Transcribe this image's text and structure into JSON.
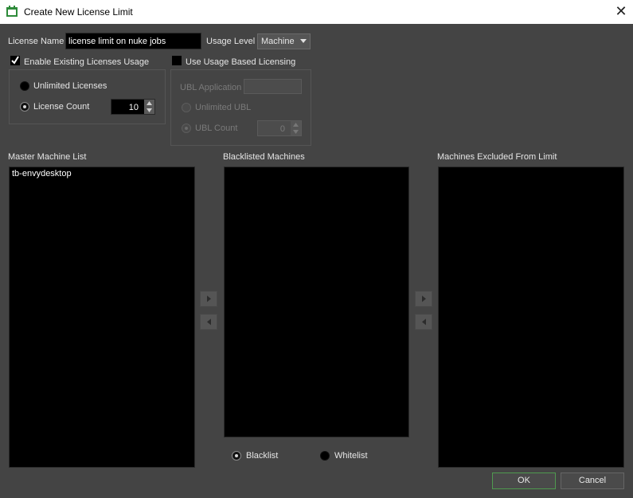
{
  "window": {
    "title": "Create New License Limit",
    "close_glyph": "✕",
    "icon": "app-icon"
  },
  "license_name": {
    "label": "License Name",
    "value": "license limit on nuke jobs"
  },
  "usage_level": {
    "label": "Usage Level",
    "selected": "Machine"
  },
  "existing_licenses": {
    "checkbox_label": "Enable Existing Licenses Usage",
    "checked": true,
    "unlimited_label": "Unlimited Licenses",
    "count_label": "License Count",
    "count_value": "10"
  },
  "ubl": {
    "checkbox_label": "Use Usage Based Licensing",
    "checked": false,
    "application_label": "UBL Application",
    "unlimited_label": "Unlimited UBL",
    "count_label": "UBL Count",
    "count_value": "0"
  },
  "lists": {
    "master_label": "Master Machine List",
    "master_items": [
      "tb-envydesktop"
    ],
    "blacklisted_label": "Blacklisted Machines",
    "excluded_label": "Machines Excluded From Limit"
  },
  "mode": {
    "blacklist_label": "Blacklist",
    "whitelist_label": "Whitelist",
    "selected": "Blacklist"
  },
  "buttons": {
    "ok": "OK",
    "cancel": "Cancel"
  },
  "colors": {
    "background": "#444444",
    "list_bg": "#000000",
    "ok_border": "#4f9a4f",
    "icon_green": "#2e8b3a"
  }
}
